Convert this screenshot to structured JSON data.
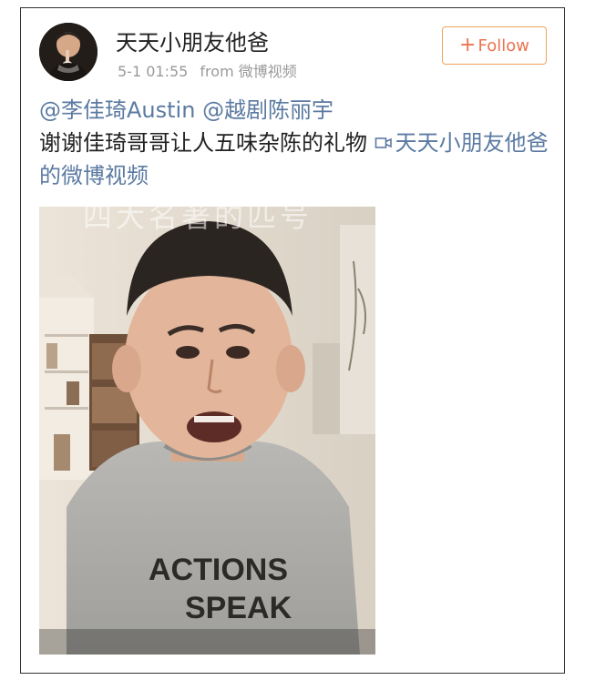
{
  "post": {
    "username": "天天小朋友他爸",
    "date": "5-1 01:55",
    "source": "from 微博视频",
    "follow_label": "Follow",
    "follow_plus": "+",
    "mention_1": "@李佳琦Austin",
    "mention_2": "@越剧陈丽宇",
    "body_text": "谢谢佳琦哥哥让人五味杂陈的礼物",
    "video_link_text": "天天小朋友他爸的微博视频",
    "video_watermark": "四大名著的匹号",
    "shirt_line_1": "ACTIONS",
    "shirt_line_2": "SPEAK"
  },
  "colors": {
    "link": "#5b7aa1",
    "follow_border": "#f0a15a",
    "follow_text": "#eb7350",
    "meta_text": "#9a9a9a"
  },
  "icons": {
    "video": "video-camera-icon"
  }
}
